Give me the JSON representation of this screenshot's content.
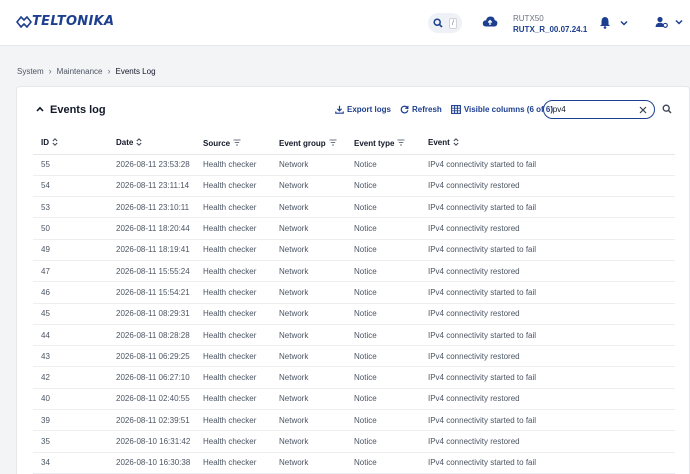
{
  "header": {
    "brand": "TELTONIKA",
    "search_shortcut": "/",
    "device_model": "RUTX50",
    "firmware": "RUTX_R_00.07.24.1"
  },
  "breadcrumb": [
    "System",
    "Maintenance",
    "Events Log"
  ],
  "card": {
    "title": "Events log",
    "export_label": "Export logs",
    "refresh_label": "Refresh",
    "visible_columns_label": "Visible columns (6 of 6)",
    "filter_value": "ipv4"
  },
  "columns": [
    "ID",
    "Date",
    "Source",
    "Event group",
    "Event type",
    "Event"
  ],
  "rows": [
    {
      "id": "55",
      "date": "2026-08-11 23:53:28",
      "source": "Health checker",
      "group": "Network",
      "type": "Notice",
      "event": "IPv4 connectivity started to fail"
    },
    {
      "id": "54",
      "date": "2026-08-11 23:11:14",
      "source": "Health checker",
      "group": "Network",
      "type": "Notice",
      "event": "IPv4 connectivity restored"
    },
    {
      "id": "53",
      "date": "2026-08-11 23:10:11",
      "source": "Health checker",
      "group": "Network",
      "type": "Notice",
      "event": "IPv4 connectivity started to fail"
    },
    {
      "id": "50",
      "date": "2026-08-11 18:20:44",
      "source": "Health checker",
      "group": "Network",
      "type": "Notice",
      "event": "IPv4 connectivity restored"
    },
    {
      "id": "49",
      "date": "2026-08-11 18:19:41",
      "source": "Health checker",
      "group": "Network",
      "type": "Notice",
      "event": "IPv4 connectivity started to fail"
    },
    {
      "id": "47",
      "date": "2026-08-11 15:55:24",
      "source": "Health checker",
      "group": "Network",
      "type": "Notice",
      "event": "IPv4 connectivity restored"
    },
    {
      "id": "46",
      "date": "2026-08-11 15:54:21",
      "source": "Health checker",
      "group": "Network",
      "type": "Notice",
      "event": "IPv4 connectivity started to fail"
    },
    {
      "id": "45",
      "date": "2026-08-11 08:29:31",
      "source": "Health checker",
      "group": "Network",
      "type": "Notice",
      "event": "IPv4 connectivity restored"
    },
    {
      "id": "44",
      "date": "2026-08-11 08:28:28",
      "source": "Health checker",
      "group": "Network",
      "type": "Notice",
      "event": "IPv4 connectivity started to fail"
    },
    {
      "id": "43",
      "date": "2026-08-11 06:29:25",
      "source": "Health checker",
      "group": "Network",
      "type": "Notice",
      "event": "IPv4 connectivity restored"
    },
    {
      "id": "42",
      "date": "2026-08-11 06:27:10",
      "source": "Health checker",
      "group": "Network",
      "type": "Notice",
      "event": "IPv4 connectivity started to fail"
    },
    {
      "id": "40",
      "date": "2026-08-11 02:40:55",
      "source": "Health checker",
      "group": "Network",
      "type": "Notice",
      "event": "IPv4 connectivity restored"
    },
    {
      "id": "39",
      "date": "2026-08-11 02:39:51",
      "source": "Health checker",
      "group": "Network",
      "type": "Notice",
      "event": "IPv4 connectivity started to fail"
    },
    {
      "id": "35",
      "date": "2026-08-10 16:31:42",
      "source": "Health checker",
      "group": "Network",
      "type": "Notice",
      "event": "IPv4 connectivity restored"
    },
    {
      "id": "34",
      "date": "2026-08-10 16:30:38",
      "source": "Health checker",
      "group": "Network",
      "type": "Notice",
      "event": "IPv4 connectivity started to fail"
    }
  ],
  "icons": {
    "brand_color": "#1d3f8f"
  }
}
